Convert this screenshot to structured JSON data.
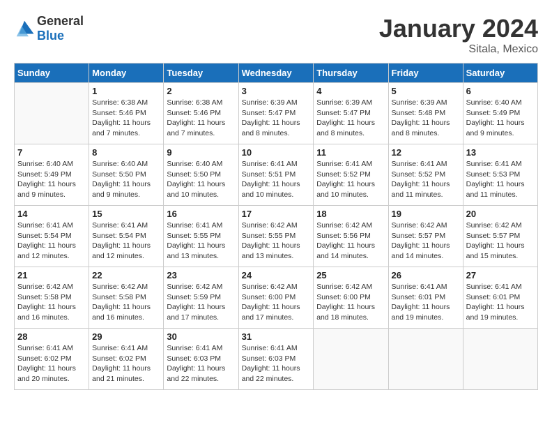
{
  "logo": {
    "text_general": "General",
    "text_blue": "Blue"
  },
  "title": "January 2024",
  "location": "Sitala, Mexico",
  "days_of_week": [
    "Sunday",
    "Monday",
    "Tuesday",
    "Wednesday",
    "Thursday",
    "Friday",
    "Saturday"
  ],
  "weeks": [
    [
      {
        "day": "",
        "info": ""
      },
      {
        "day": "1",
        "info": "Sunrise: 6:38 AM\nSunset: 5:46 PM\nDaylight: 11 hours\nand 7 minutes."
      },
      {
        "day": "2",
        "info": "Sunrise: 6:38 AM\nSunset: 5:46 PM\nDaylight: 11 hours\nand 7 minutes."
      },
      {
        "day": "3",
        "info": "Sunrise: 6:39 AM\nSunset: 5:47 PM\nDaylight: 11 hours\nand 8 minutes."
      },
      {
        "day": "4",
        "info": "Sunrise: 6:39 AM\nSunset: 5:47 PM\nDaylight: 11 hours\nand 8 minutes."
      },
      {
        "day": "5",
        "info": "Sunrise: 6:39 AM\nSunset: 5:48 PM\nDaylight: 11 hours\nand 8 minutes."
      },
      {
        "day": "6",
        "info": "Sunrise: 6:40 AM\nSunset: 5:49 PM\nDaylight: 11 hours\nand 9 minutes."
      }
    ],
    [
      {
        "day": "7",
        "info": "Sunrise: 6:40 AM\nSunset: 5:49 PM\nDaylight: 11 hours\nand 9 minutes."
      },
      {
        "day": "8",
        "info": "Sunrise: 6:40 AM\nSunset: 5:50 PM\nDaylight: 11 hours\nand 9 minutes."
      },
      {
        "day": "9",
        "info": "Sunrise: 6:40 AM\nSunset: 5:50 PM\nDaylight: 11 hours\nand 10 minutes."
      },
      {
        "day": "10",
        "info": "Sunrise: 6:41 AM\nSunset: 5:51 PM\nDaylight: 11 hours\nand 10 minutes."
      },
      {
        "day": "11",
        "info": "Sunrise: 6:41 AM\nSunset: 5:52 PM\nDaylight: 11 hours\nand 10 minutes."
      },
      {
        "day": "12",
        "info": "Sunrise: 6:41 AM\nSunset: 5:52 PM\nDaylight: 11 hours\nand 11 minutes."
      },
      {
        "day": "13",
        "info": "Sunrise: 6:41 AM\nSunset: 5:53 PM\nDaylight: 11 hours\nand 11 minutes."
      }
    ],
    [
      {
        "day": "14",
        "info": "Sunrise: 6:41 AM\nSunset: 5:54 PM\nDaylight: 11 hours\nand 12 minutes."
      },
      {
        "day": "15",
        "info": "Sunrise: 6:41 AM\nSunset: 5:54 PM\nDaylight: 11 hours\nand 12 minutes."
      },
      {
        "day": "16",
        "info": "Sunrise: 6:41 AM\nSunset: 5:55 PM\nDaylight: 11 hours\nand 13 minutes."
      },
      {
        "day": "17",
        "info": "Sunrise: 6:42 AM\nSunset: 5:55 PM\nDaylight: 11 hours\nand 13 minutes."
      },
      {
        "day": "18",
        "info": "Sunrise: 6:42 AM\nSunset: 5:56 PM\nDaylight: 11 hours\nand 14 minutes."
      },
      {
        "day": "19",
        "info": "Sunrise: 6:42 AM\nSunset: 5:57 PM\nDaylight: 11 hours\nand 14 minutes."
      },
      {
        "day": "20",
        "info": "Sunrise: 6:42 AM\nSunset: 5:57 PM\nDaylight: 11 hours\nand 15 minutes."
      }
    ],
    [
      {
        "day": "21",
        "info": "Sunrise: 6:42 AM\nSunset: 5:58 PM\nDaylight: 11 hours\nand 16 minutes."
      },
      {
        "day": "22",
        "info": "Sunrise: 6:42 AM\nSunset: 5:58 PM\nDaylight: 11 hours\nand 16 minutes."
      },
      {
        "day": "23",
        "info": "Sunrise: 6:42 AM\nSunset: 5:59 PM\nDaylight: 11 hours\nand 17 minutes."
      },
      {
        "day": "24",
        "info": "Sunrise: 6:42 AM\nSunset: 6:00 PM\nDaylight: 11 hours\nand 17 minutes."
      },
      {
        "day": "25",
        "info": "Sunrise: 6:42 AM\nSunset: 6:00 PM\nDaylight: 11 hours\nand 18 minutes."
      },
      {
        "day": "26",
        "info": "Sunrise: 6:41 AM\nSunset: 6:01 PM\nDaylight: 11 hours\nand 19 minutes."
      },
      {
        "day": "27",
        "info": "Sunrise: 6:41 AM\nSunset: 6:01 PM\nDaylight: 11 hours\nand 19 minutes."
      }
    ],
    [
      {
        "day": "28",
        "info": "Sunrise: 6:41 AM\nSunset: 6:02 PM\nDaylight: 11 hours\nand 20 minutes."
      },
      {
        "day": "29",
        "info": "Sunrise: 6:41 AM\nSunset: 6:02 PM\nDaylight: 11 hours\nand 21 minutes."
      },
      {
        "day": "30",
        "info": "Sunrise: 6:41 AM\nSunset: 6:03 PM\nDaylight: 11 hours\nand 22 minutes."
      },
      {
        "day": "31",
        "info": "Sunrise: 6:41 AM\nSunset: 6:03 PM\nDaylight: 11 hours\nand 22 minutes."
      },
      {
        "day": "",
        "info": ""
      },
      {
        "day": "",
        "info": ""
      },
      {
        "day": "",
        "info": ""
      }
    ]
  ]
}
